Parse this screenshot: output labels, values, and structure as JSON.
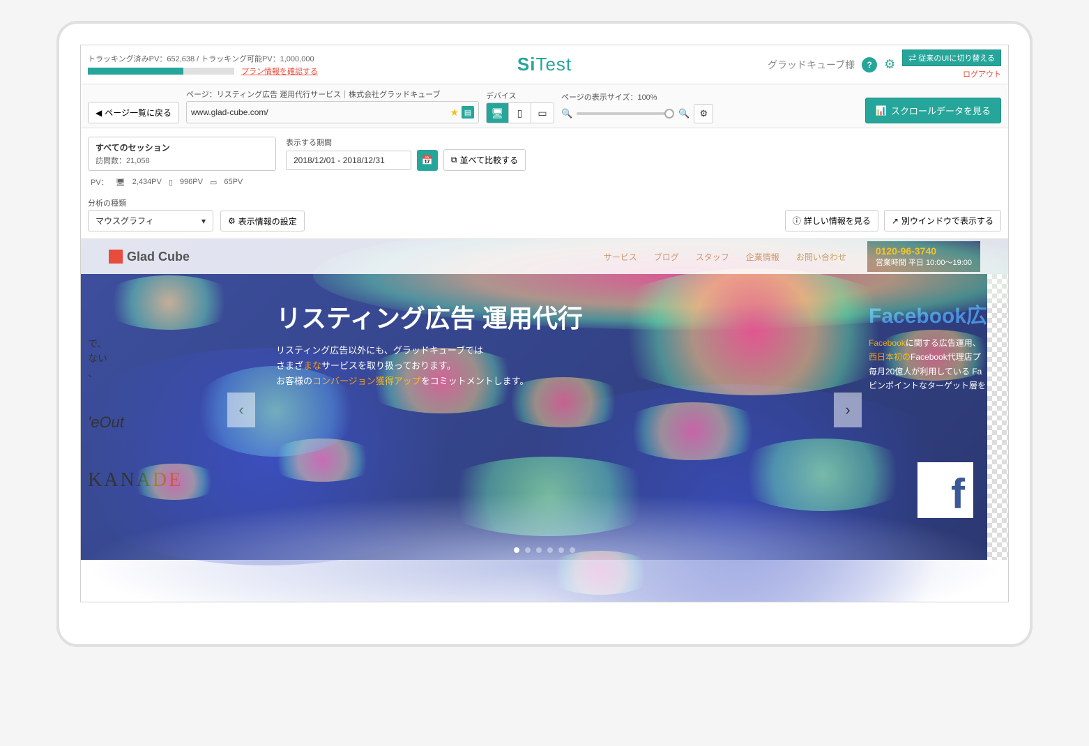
{
  "topbar": {
    "pv_tracked_label": "トラッキング済みPV：",
    "pv_tracked_value": "652,638",
    "pv_separator": " / ",
    "pv_limit_label": "トラッキング可能PV：",
    "pv_limit_value": "1,000,000",
    "plan_link": "プラン情報を確認する",
    "logo_si": "Si",
    "logo_test": "Test",
    "username": "グラッドキューブ様",
    "switch_ui_btn": "⇄ 従来のUIに切り替える",
    "logout": "ログアウト"
  },
  "row2": {
    "back_btn": "ページ一覧に戻る",
    "page_label": "ページ：リスティング広告 運用代行サービス｜株式会社グラッドキューブ",
    "url_value": "www.glad-cube.com/",
    "device_label": "デバイス",
    "zoom_label": "ページの表示サイズ：100%",
    "scroll_btn": "スクロールデータを見る"
  },
  "row3": {
    "session_title": "すべてのセッション",
    "session_sub_label": "訪問数：",
    "session_sub_value": "21,058",
    "period_label": "表示する期間",
    "date_range": "2018/12/01 - 2018/12/31",
    "compare_btn": "並べて比較する"
  },
  "pv_breakdown": {
    "prefix": "PV：",
    "desktop": "2,434PV",
    "tablet": "996PV",
    "mobile": "65PV"
  },
  "analysis": {
    "type_label": "分析の種類",
    "select_value": "マウスグラフィ",
    "settings_btn": "表示情報の設定",
    "detail_btn": "詳しい情報を見る",
    "new_window_btn": "別ウインドウで表示する"
  },
  "site": {
    "logo": "Glad Cube",
    "nav": [
      "サービス",
      "ブログ",
      "スタッフ",
      "企業情報",
      "お問い合わせ"
    ],
    "phone": "0120-96-3740",
    "phone_hours": "営業時間 平日 10:00〜19:00",
    "hero_title": "リスティング広告 運用代行",
    "hero_sub1": "リスティング広告以外にも、グラッドキューブでは",
    "hero_sub2": "さまざまなサービスを取り扱っております。",
    "hero_sub3": "お客様のコンバージョン獲得アップをコミットメントします。",
    "hero2_title": "Facebook広",
    "hero2_sub1": "Facebookに関する広告運用、",
    "hero2_sub2": "西日本初のFacebook代理店プ",
    "hero2_sub3": "毎月20億人が利用している Fa",
    "hero2_sub4": "ピンポイントなターゲット層を",
    "side_text": "で、\nない\n、",
    "side_logo1": "'eOut",
    "side_logo2": "KANADE"
  }
}
